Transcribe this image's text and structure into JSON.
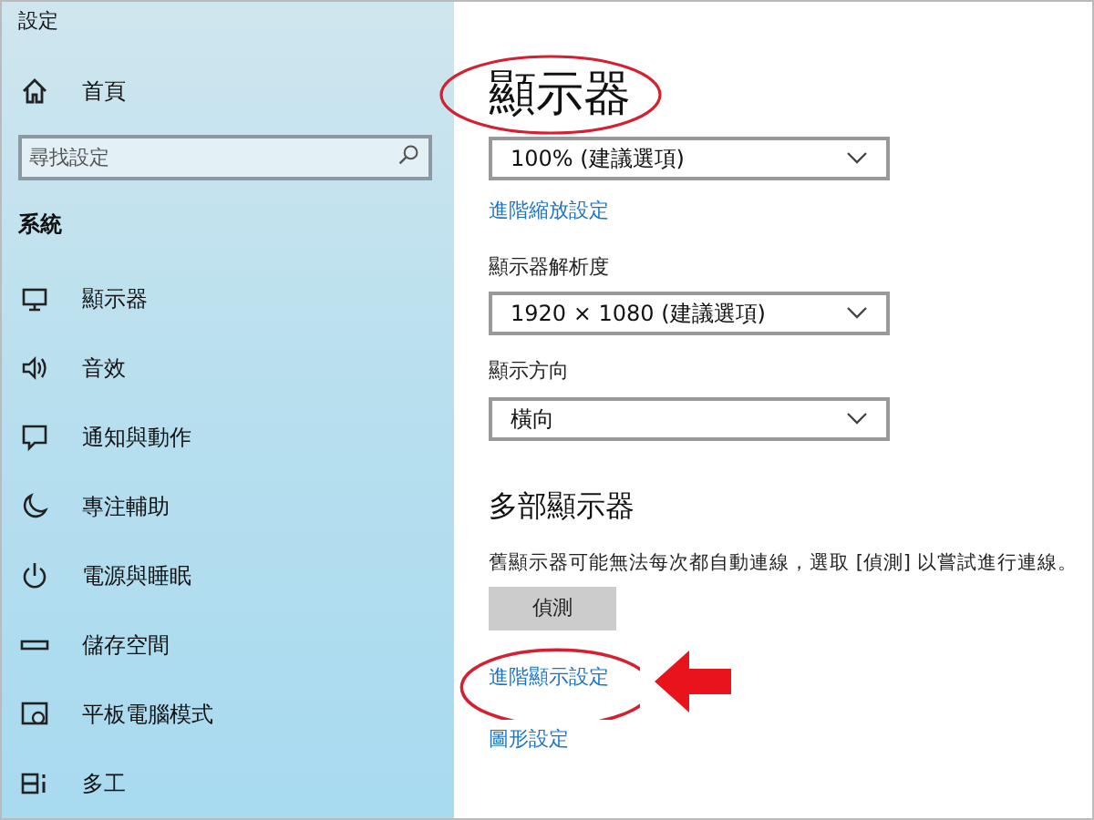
{
  "window": {
    "title": "設定"
  },
  "sidebar": {
    "home": "首頁",
    "search": {
      "placeholder": "尋找設定"
    },
    "section": "系統",
    "items": [
      {
        "label": "顯示器"
      },
      {
        "label": "音效"
      },
      {
        "label": "通知與動作"
      },
      {
        "label": "專注輔助"
      },
      {
        "label": "電源與睡眠"
      },
      {
        "label": "儲存空間"
      },
      {
        "label": "平板電腦模式"
      },
      {
        "label": "多工"
      }
    ]
  },
  "main": {
    "title": "顯示器",
    "scale": {
      "value": "100% (建議選項)"
    },
    "scale_link": "進階縮放設定",
    "resolution": {
      "label": "顯示器解析度",
      "value": "1920 × 1080 (建議選項)"
    },
    "orientation": {
      "label": "顯示方向",
      "value": "橫向"
    },
    "multi": {
      "heading": "多部顯示器",
      "text": "舊顯示器可能無法每次都自動連線，選取 [偵測] 以嘗試進行連線。",
      "button": "偵測"
    },
    "links": [
      "進階顯示設定",
      "圖形設定"
    ]
  }
}
